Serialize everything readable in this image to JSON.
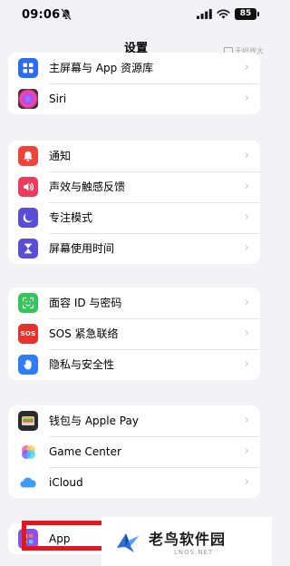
{
  "status_bar": {
    "time": "09:06",
    "battery": "85",
    "icons": [
      "bell-slash-icon",
      "signal-icon",
      "wifi-icon",
      "battery-icon"
    ]
  },
  "nav": {
    "title": "设置",
    "floating_badge": "无损放大"
  },
  "groups": [
    {
      "rows": [
        {
          "label": "主屏幕与 App 资源库",
          "icon": "home-screen-icon",
          "color": "#2f6bf0"
        },
        {
          "label": "Siri",
          "icon": "siri-icon",
          "color": "#1c1c2e"
        }
      ]
    },
    {
      "rows": [
        {
          "label": "通知",
          "icon": "notification-bell-icon",
          "color": "#f0443a"
        },
        {
          "label": "声效与触感反馈",
          "icon": "speaker-icon",
          "color": "#ee3a5e"
        },
        {
          "label": "专注模式",
          "icon": "moon-icon",
          "color": "#5a4fd4"
        },
        {
          "label": "屏幕使用时间",
          "icon": "hourglass-icon",
          "color": "#5a4fd4"
        }
      ]
    },
    {
      "rows": [
        {
          "label": "面容 ID 与密码",
          "icon": "face-id-icon",
          "color": "#34c759"
        },
        {
          "label": "SOS 紧急联络",
          "icon": "sos-icon",
          "color": "#e8322e",
          "icon_text": "SOS"
        },
        {
          "label": "隐私与安全性",
          "icon": "hand-icon",
          "color": "#2f7cf6"
        }
      ]
    },
    {
      "rows": [
        {
          "label": "钱包与 Apple Pay",
          "icon": "wallet-icon",
          "color": "#2b2b2b"
        },
        {
          "label": "Game Center",
          "icon": "game-center-icon",
          "color": "#ffffff"
        },
        {
          "label": "iCloud",
          "icon": "icloud-icon",
          "color": "#ffffff"
        }
      ]
    },
    {
      "rows": [
        {
          "label": "App",
          "icon": "app-icon",
          "color": "#5a4fd4"
        }
      ]
    }
  ],
  "watermark": {
    "title": "老鸟软件园",
    "url": "LNOS.NET"
  }
}
